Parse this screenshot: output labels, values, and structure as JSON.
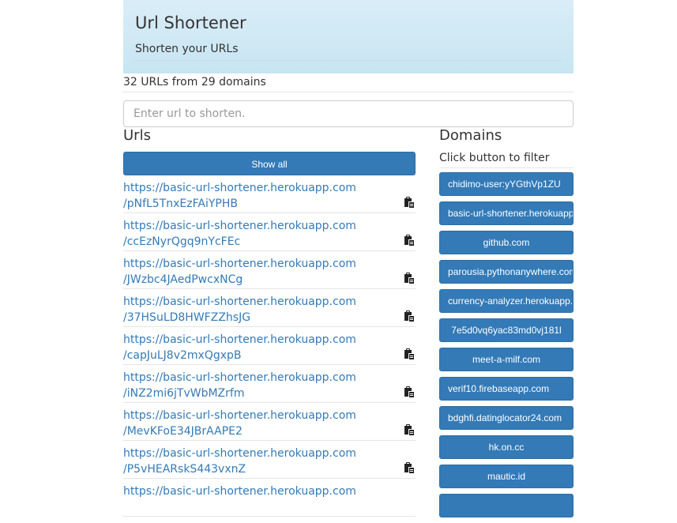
{
  "header": {
    "title": "Url Shortener",
    "subtitle": "Shorten your URLs"
  },
  "stats": "32 URLs from 29 domains",
  "input": {
    "placeholder": "Enter url to shorten.",
    "value": ""
  },
  "urls": {
    "heading": "Urls",
    "show_all_label": "Show all",
    "items": [
      {
        "line1": "https://basic-url-shortener.herokuapp.com",
        "line2": "/pNfL5TnxEzFAiYPHB"
      },
      {
        "line1": "https://basic-url-shortener.herokuapp.com",
        "line2": "/ccEzNyrQgq9nYcFEc"
      },
      {
        "line1": "https://basic-url-shortener.herokuapp.com",
        "line2": "/JWzbc4JAedPwcxNCg"
      },
      {
        "line1": "https://basic-url-shortener.herokuapp.com",
        "line2": "/37HSuLD8HWFZZhsJG"
      },
      {
        "line1": "https://basic-url-shortener.herokuapp.com",
        "line2": "/capJuLJ8v2mxQgxpB"
      },
      {
        "line1": "https://basic-url-shortener.herokuapp.com",
        "line2": "/iNZ2mi6jTvWbMZrfm"
      },
      {
        "line1": "https://basic-url-shortener.herokuapp.com",
        "line2": "/MevKFoE34JBrAAPE2"
      },
      {
        "line1": "https://basic-url-shortener.herokuapp.com",
        "line2": "/P5vHEARskS443vxnZ"
      },
      {
        "line1": "https://basic-url-shortener.herokuapp.com",
        "line2": ""
      }
    ],
    "copy_icon": "clipboard-icon"
  },
  "domains": {
    "heading": "Domains",
    "hint": "Click button to filter",
    "items": [
      {
        "label": "chidimo-user:yYGthVp1ZU"
      },
      {
        "label": "basic-url-shortener.herokuapp.com"
      },
      {
        "label": "github.com"
      },
      {
        "label": "parousia.pythonanywhere.com"
      },
      {
        "label": "currency-analyzer.herokuapp.com"
      },
      {
        "label": "7e5d0vq6yac83md0vj181l"
      },
      {
        "label": "meet-a-milf.com"
      },
      {
        "label": "verif10.firebaseapp.com"
      },
      {
        "label": "bdghfi.datinglocator24.com"
      },
      {
        "label": "hk.on.cc"
      },
      {
        "label": "mautic.id"
      },
      {
        "label": ""
      }
    ]
  },
  "colors": {
    "primary": "#337ab7",
    "link": "#337ab7",
    "header_bg": "#d9edf7"
  }
}
